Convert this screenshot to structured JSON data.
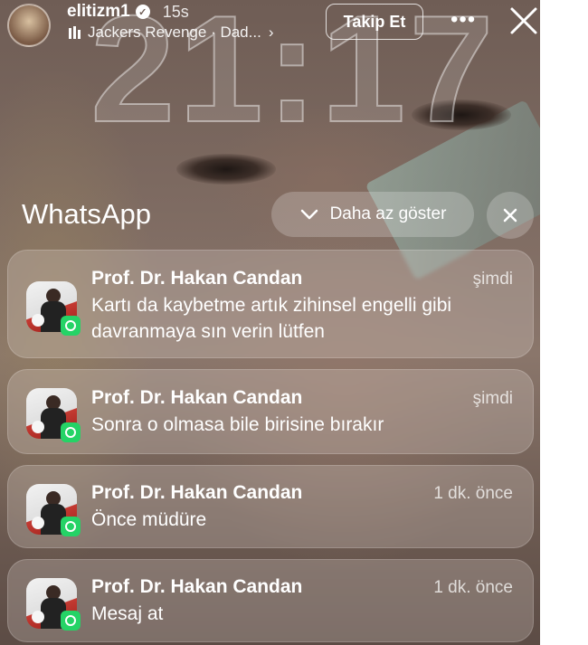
{
  "story": {
    "username": "elitizm1",
    "time_ago": "15s",
    "music": "Jackers Revenge · Dad...",
    "follow_label": "Takip Et",
    "more_icon": "more-icon",
    "close_icon": "close-icon"
  },
  "lockscreen": {
    "clock": "21:17"
  },
  "whatsapp": {
    "title": "WhatsApp",
    "show_less_label": "Daha az göster"
  },
  "notifications": [
    {
      "sender": "Prof. Dr. Hakan Candan",
      "time": "şimdi",
      "message": "Kartı da kaybetme artık zihinsel engelli gibi davranmaya sın verin lütfen"
    },
    {
      "sender": "Prof. Dr. Hakan Candan",
      "time": "şimdi",
      "message": "Sonra o olmasa bile birisine bırakır"
    },
    {
      "sender": "Prof. Dr. Hakan Candan",
      "time": "1 dk. önce",
      "message": "Önce müdüre"
    },
    {
      "sender": "Prof. Dr. Hakan Candan",
      "time": "1 dk. önce",
      "message": "Mesaj at"
    }
  ],
  "colors": {
    "whatsapp_green": "#25d366"
  }
}
